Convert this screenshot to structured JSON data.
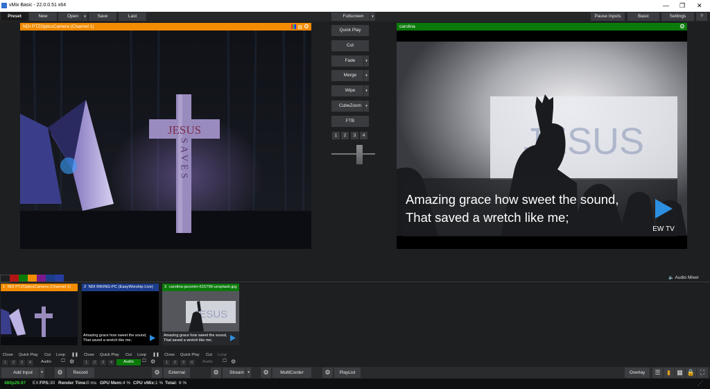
{
  "window": {
    "title": "vMix Basic - 22.0.0.51 x64",
    "min": "—",
    "max": "❐",
    "close": "✕"
  },
  "menu": {
    "preset": "Preset",
    "new": "New",
    "open": "Open",
    "save": "Save",
    "last": "Last",
    "fullscreen": "Fullscreen",
    "pause_inputs": "Pause Inputs",
    "basic": "Basic",
    "settings": "Settings",
    "help": "?"
  },
  "preview": {
    "title": "NDI PTZOpticsCamera (Channel 1)"
  },
  "output": {
    "title": "carolina",
    "caption_line1": "Amazing grace how sweet the sound,",
    "caption_line2": "That saved a wretch like me;",
    "brand": "EW TV",
    "bg_word": "JESUS"
  },
  "cross": {
    "word1": "JESUS",
    "word2": "SAVES"
  },
  "transitions": {
    "quick_play": "Quick Play",
    "cut": "Cut",
    "fade": "Fade",
    "merge": "Merge",
    "wipe": "Wipe",
    "cubezoom": "CubeZoom",
    "ftb": "FTB",
    "numbers": [
      "1",
      "2",
      "3",
      "4"
    ]
  },
  "colors": {
    "orange": "#f28c00",
    "green": "#0b7a0b",
    "blue": "#1c3d8c",
    "red": "#b01515",
    "purple": "#7a1a8c"
  },
  "audio_mixer": "Audio Mixer",
  "inputs": [
    {
      "num": "1",
      "title": "NDI PTZOpticsCamera (Channel 1)",
      "color": "#f28c00"
    },
    {
      "num": "2",
      "title": "NDI RIKING-PC (EasyWorship Live)",
      "color": "#1c3d8c"
    },
    {
      "num": "3",
      "title": "carolina-jacomin-615796-unsplash.jpg",
      "color": "#0b7a0b"
    }
  ],
  "thumb_caption": {
    "line1": "Amazing grace how sweet the sound,",
    "line2": "That saved a wretch like me;"
  },
  "input_controls": {
    "close": "Close",
    "quick_play": "Quick Play",
    "cut": "Cut",
    "loop": "Loop",
    "audio": "Audio",
    "pause": "❚❚"
  },
  "bottom": {
    "add_input": "Add Input",
    "record": "Record",
    "external": "External",
    "stream": "Stream",
    "multicorder": "MultiCorder",
    "playlist": "PlayList",
    "overlay": "Overlay"
  },
  "status": {
    "format": "480p29.97",
    "ex": "EX",
    "fps_label": "FPS:",
    "fps": "30",
    "render_label": "Render Time:",
    "render": "0 ms",
    "gpu_label": "GPU Mem:",
    "gpu": "4 %",
    "cpu_label": "CPU vMix:",
    "cpu": "1 %",
    "total_label": "Total:",
    "total": "6 %"
  }
}
